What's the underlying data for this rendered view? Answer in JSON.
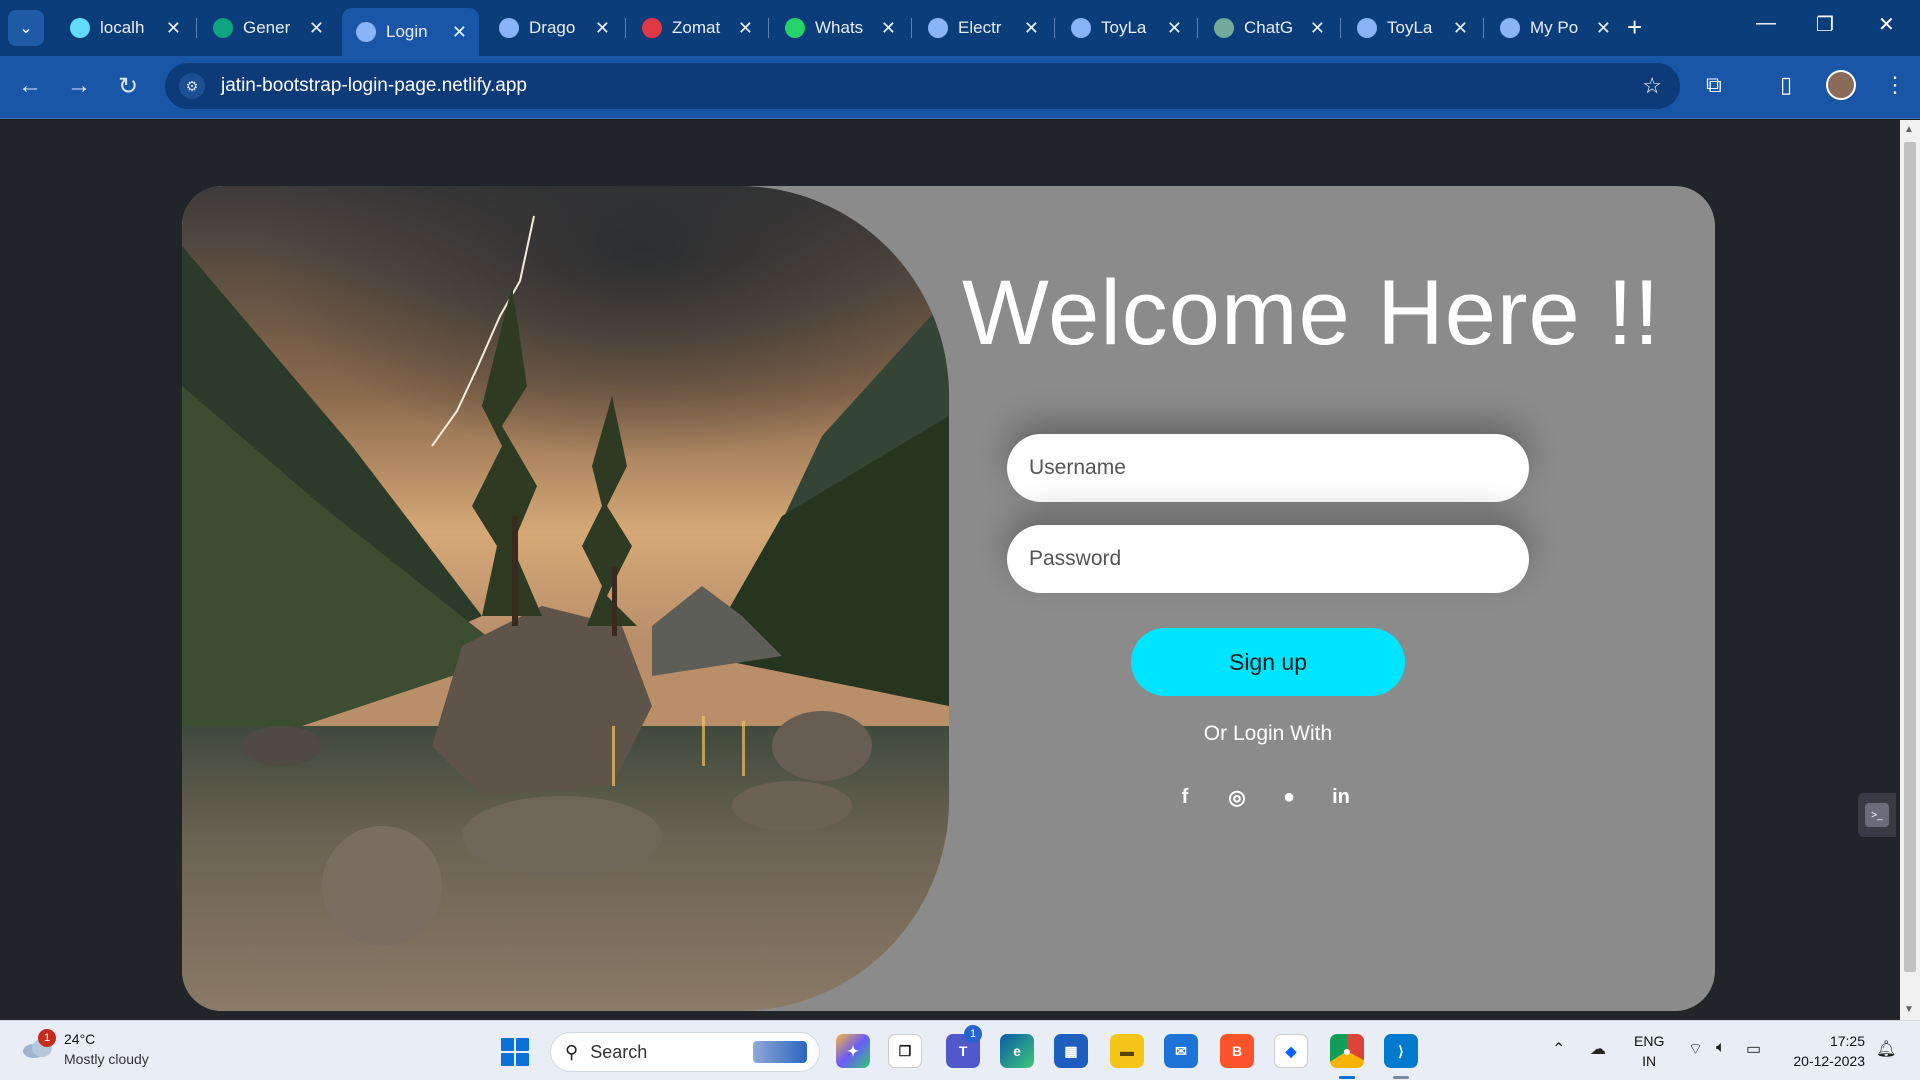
{
  "browser": {
    "tabs": [
      {
        "title": "localh",
        "favicon": "react-icon",
        "color": "#61dafb"
      },
      {
        "title": "Gener",
        "favicon": "diamond-icon",
        "color": "#10a37f"
      },
      {
        "title": "Login",
        "favicon": "globe-icon",
        "color": "#8ab4f8",
        "active": true
      },
      {
        "title": "Drago",
        "favicon": "globe-icon",
        "color": "#8ab4f8"
      },
      {
        "title": "Zomat",
        "favicon": "zomato-icon",
        "color": "#e23744"
      },
      {
        "title": "Whats",
        "favicon": "whatsapp-icon",
        "color": "#25d366"
      },
      {
        "title": "Electr",
        "favicon": "globe-icon",
        "color": "#8ab4f8"
      },
      {
        "title": "ToyLa",
        "favicon": "globe-icon",
        "color": "#8ab4f8"
      },
      {
        "title": "ChatG",
        "favicon": "chatgpt-icon",
        "color": "#74aa9c"
      },
      {
        "title": "ToyLa",
        "favicon": "globe-icon",
        "color": "#8ab4f8"
      },
      {
        "title": "My Po",
        "favicon": "globe-icon",
        "color": "#8ab4f8"
      }
    ],
    "url": "jatin-bootstrap-login-page.netlify.app"
  },
  "login": {
    "heading": "Welcome Here !!",
    "username_placeholder": "Username",
    "password_placeholder": "Password",
    "signup_label": "Sign up",
    "or_login_with": "Or Login With",
    "accent_color": "#00e5ff",
    "socials": [
      {
        "name": "facebook-icon",
        "glyph": "f"
      },
      {
        "name": "instagram-icon",
        "glyph": "◎"
      },
      {
        "name": "github-icon",
        "glyph": "●"
      },
      {
        "name": "linkedin-icon",
        "glyph": "in"
      }
    ]
  },
  "taskbar": {
    "weather_badge": "1",
    "weather_temp": "24°C",
    "weather_desc": "Mostly cloudy",
    "search_label": "Search",
    "teams_badge": "1",
    "lang_top": "ENG",
    "lang_bottom": "IN",
    "time": "17:25",
    "date": "20-12-2023"
  }
}
